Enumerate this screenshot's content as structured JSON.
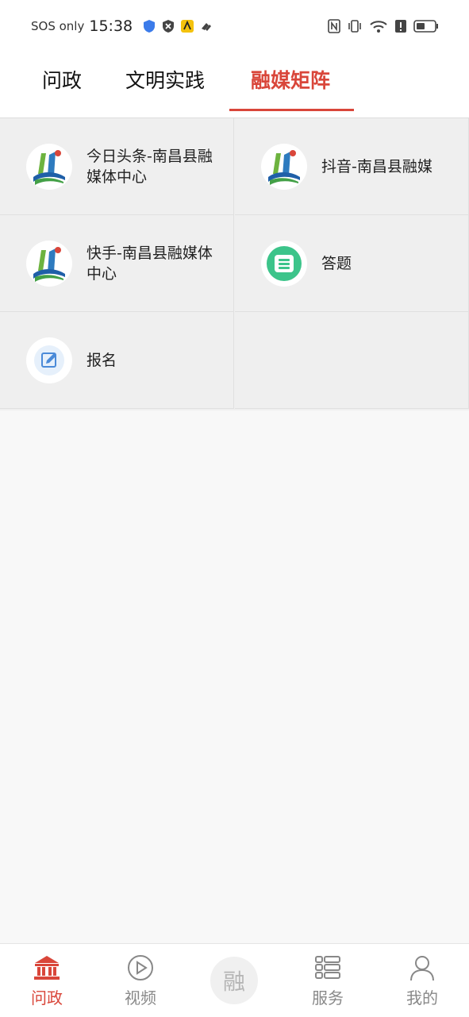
{
  "status_bar": {
    "sos": "SOS only",
    "time": "15:38"
  },
  "tabs": [
    {
      "label": "问政",
      "active": false
    },
    {
      "label": "文明实践",
      "active": false
    },
    {
      "label": "融媒矩阵",
      "active": true
    }
  ],
  "grid": [
    {
      "label": "今日头条-南昌县融媒体中心",
      "icon": "nanchang-logo-icon"
    },
    {
      "label": "抖音-南昌县融媒",
      "icon": "nanchang-logo-icon"
    },
    {
      "label": "快手-南昌县融媒体中心",
      "icon": "nanchang-logo-icon"
    },
    {
      "label": "答题",
      "icon": "quiz-icon"
    },
    {
      "label": "报名",
      "icon": "edit-icon"
    }
  ],
  "bottom_nav": [
    {
      "label": "问政",
      "icon": "government-building-icon",
      "active": true
    },
    {
      "label": "视频",
      "icon": "play-circle-icon",
      "active": false
    },
    {
      "label": "融",
      "icon": "center-rong-button",
      "active": false
    },
    {
      "label": "服务",
      "icon": "service-list-icon",
      "active": false
    },
    {
      "label": "我的",
      "icon": "user-icon",
      "active": false
    }
  ],
  "colors": {
    "accent": "#d9463a",
    "grid_bg": "#efefef",
    "page_bg": "#f8f8f8"
  }
}
